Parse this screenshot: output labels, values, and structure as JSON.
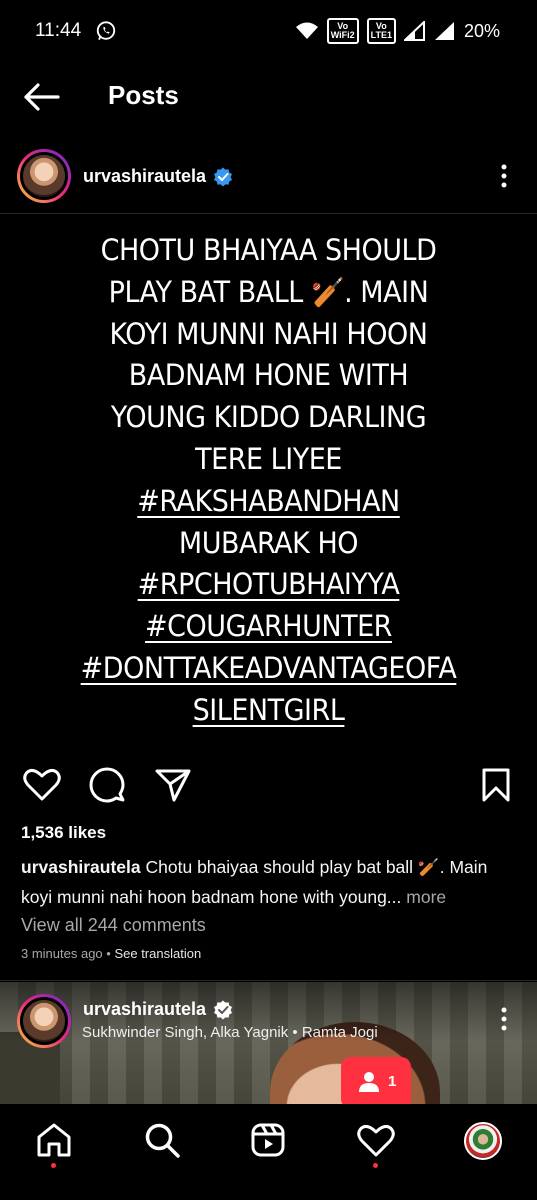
{
  "status_bar": {
    "time": "11:44",
    "battery": "20%",
    "vowifi": "Vo\nWiFi2",
    "volte": "Vo\nLTE1"
  },
  "header": {
    "title": "Posts"
  },
  "post": {
    "username": "urvashirautela",
    "verified": true,
    "body_lines": [
      {
        "text": "CHOTU BHAIYAA SHOULD",
        "tag": false
      },
      {
        "text": "PLAY BAT BALL 🏏. MAIN",
        "tag": false
      },
      {
        "text": "KOYI MUNNI NAHI HOON",
        "tag": false
      },
      {
        "text": "BADNAM HONE WITH",
        "tag": false
      },
      {
        "text": "YOUNG KIDDO DARLING",
        "tag": false
      },
      {
        "text": "TERE LIYEE",
        "tag": false
      },
      {
        "text": "#RAKSHABANDHAN",
        "tag": true
      },
      {
        "text": "MUBARAK HO",
        "tag": false
      },
      {
        "text": "#RPCHOTUBHAIYYA",
        "tag": true
      },
      {
        "text": "#COUGARHUNTER",
        "tag": true
      },
      {
        "text": "#DONTTAKEADVANTAGEOFA",
        "tag": true
      },
      {
        "text": "SILENTGIRL",
        "tag": true
      }
    ],
    "likes": "1,536 likes",
    "caption_user": "urvashirautela",
    "caption_line1": "Chotu bhaiyaa should play bat ball 🏏. Main",
    "caption_line2": "koyi munni nahi hoon badnam hone with young...",
    "caption_more": "more",
    "view_comments": "View all 244 comments",
    "time_ago": "3 minutes ago",
    "separator": " • ",
    "see_translation": "See translation"
  },
  "next_post": {
    "username": "urvashirautela",
    "verified": true,
    "audio": "Sukhwinder Singh, Alka Yagnik • Ramta Jogi"
  },
  "notification": {
    "icon": "person-icon",
    "count": "1"
  },
  "bottom_nav": {
    "items": [
      "home-icon",
      "search-icon",
      "reels-icon",
      "heart-icon",
      "profile-avatar"
    ]
  },
  "colors": {
    "background": "#000000",
    "verified_blue": "#3897f0",
    "notification_red": "#ff3040",
    "muted_text": "#a8a8a8"
  }
}
